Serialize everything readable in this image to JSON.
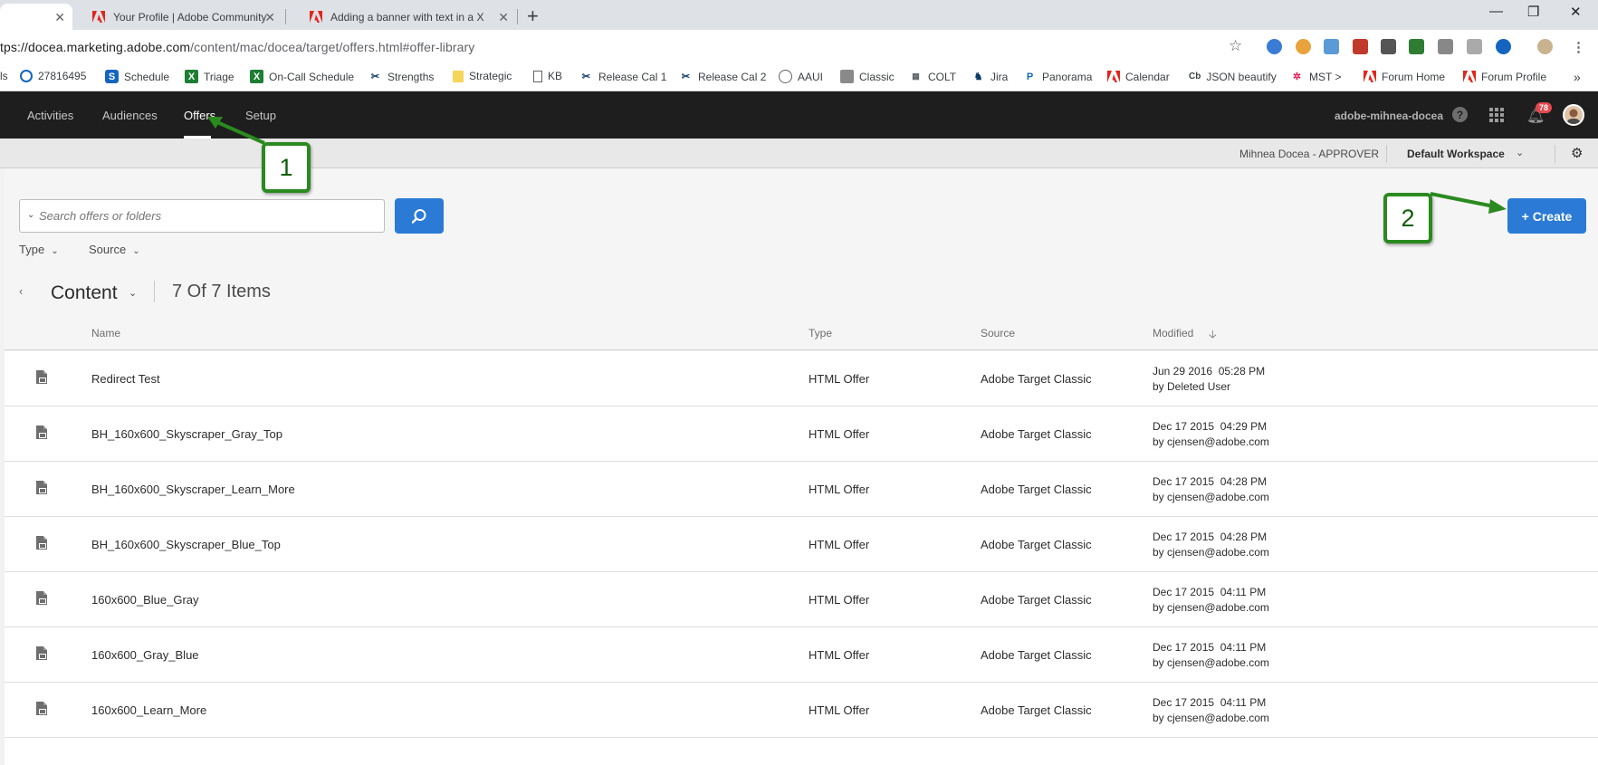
{
  "browser": {
    "tabs": [
      {
        "title": "",
        "active": true
      },
      {
        "title": "Your Profile | Adobe Community",
        "active": false
      },
      {
        "title": "Adding a banner with text in a X",
        "active": false
      }
    ],
    "url_main": "tps://docea.marketing.adobe.com",
    "url_path": "/content/mac/docea/target/offers.html#offer-library",
    "bookmarks": [
      "ls",
      "27816495",
      "Schedule",
      "Triage",
      "On-Call Schedule",
      "Strengths",
      "Strategic",
      "KB",
      "Release Cal 1",
      "Release Cal 2",
      "AAUI",
      "Classic",
      "COLT",
      "Jira",
      "Panorama",
      "Calendar",
      "JSON beautify",
      "MST >",
      "Forum Home",
      "Forum Profile"
    ],
    "bookmark_more": "»",
    "bookmark_icons": [
      "",
      "",
      "",
      "",
      "",
      "",
      "",
      "",
      "",
      "",
      "",
      "",
      "",
      "",
      "",
      "",
      "Cb",
      "",
      "",
      ""
    ]
  },
  "app": {
    "nav": [
      "Activities",
      "Audiences",
      "Offers",
      "Setup"
    ],
    "active_nav": "Offers",
    "user_name": "adobe-mihnea-docea",
    "notification_count": "78",
    "help_glyph": "?",
    "role": "Mihnea Docea - APPROVER",
    "workspace": "Default Workspace"
  },
  "library": {
    "search_placeholder": "Search offers or folders",
    "filters": [
      "Type",
      "Source"
    ],
    "folder": "Content",
    "count_label": "7 Of 7 Items",
    "create_label": "+  Create",
    "columns": {
      "name": "Name",
      "type": "Type",
      "source": "Source",
      "modified": "Modified"
    },
    "rows": [
      {
        "name": "Redirect Test",
        "type": "HTML Offer",
        "source": "Adobe Target Classic",
        "date": "Jun 29 2016  05:28 PM",
        "by": "by Deleted User"
      },
      {
        "name": "BH_160x600_Skyscraper_Gray_Top",
        "type": "HTML Offer",
        "source": "Adobe Target Classic",
        "date": "Dec 17 2015  04:29 PM",
        "by": "by cjensen@adobe.com"
      },
      {
        "name": "BH_160x600_Skyscraper_Learn_More",
        "type": "HTML Offer",
        "source": "Adobe Target Classic",
        "date": "Dec 17 2015  04:28 PM",
        "by": "by cjensen@adobe.com"
      },
      {
        "name": "BH_160x600_Skyscraper_Blue_Top",
        "type": "HTML Offer",
        "source": "Adobe Target Classic",
        "date": "Dec 17 2015  04:28 PM",
        "by": "by cjensen@adobe.com"
      },
      {
        "name": "160x600_Blue_Gray",
        "type": "HTML Offer",
        "source": "Adobe Target Classic",
        "date": "Dec 17 2015  04:11 PM",
        "by": "by cjensen@adobe.com"
      },
      {
        "name": "160x600_Gray_Blue",
        "type": "HTML Offer",
        "source": "Adobe Target Classic",
        "date": "Dec 17 2015  04:11 PM",
        "by": "by cjensen@adobe.com"
      },
      {
        "name": "160x600_Learn_More",
        "type": "HTML Offer",
        "source": "Adobe Target Classic",
        "date": "Dec 17 2015  04:11 PM",
        "by": "by cjensen@adobe.com"
      }
    ]
  },
  "annotations": [
    "1",
    "2"
  ],
  "colors": {
    "accent": "#2b7ad6",
    "nav_bg": "#1e1e1e",
    "callout_green": "#2a8a1f"
  },
  "icons": {
    "tab": "adobe-icon",
    "file": "file-icon",
    "search": "search-icon",
    "gear": "gear-icon",
    "bell": "bell-icon"
  }
}
